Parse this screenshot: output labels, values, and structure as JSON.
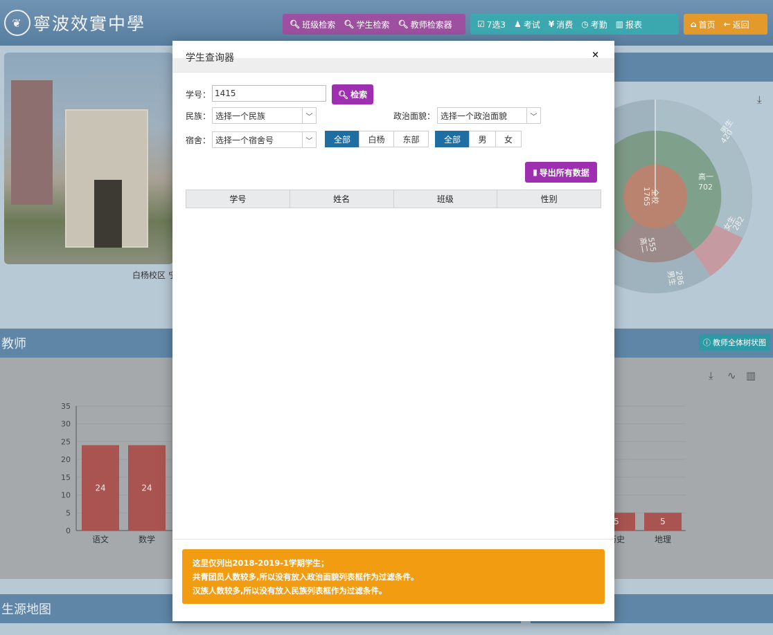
{
  "app": {
    "school_name": "寧波效實中學",
    "nav_search": [
      {
        "icon": "search-icon",
        "label": "班级检索"
      },
      {
        "icon": "search-icon",
        "label": "学生检索"
      },
      {
        "icon": "search-icon",
        "label": "教师检索器"
      }
    ],
    "nav_main": [
      {
        "icon": "check-icon",
        "label": "7选3"
      },
      {
        "icon": "user-icon",
        "label": "考试"
      },
      {
        "icon": "yen-icon",
        "label": "消费"
      },
      {
        "icon": "clock-icon",
        "label": "考勤"
      },
      {
        "icon": "bar-chart-icon",
        "label": "报表"
      }
    ],
    "nav_home": {
      "icon": "home-icon",
      "label": "首页"
    },
    "nav_back": {
      "icon": "arrow-left-icon",
      "label": "返回"
    }
  },
  "background": {
    "photo_caption": "白杨校区 宁",
    "teacher_section": "教师",
    "teacher_tree_button": "教师全体树状图",
    "source_section": "生源地图",
    "chart_data": [
      {
        "type": "bar",
        "categories": [
          "语文",
          "数学",
          "历史",
          "地理"
        ],
        "values": [
          24,
          24,
          5,
          5
        ],
        "ylim": [
          0,
          35
        ],
        "yticks": [
          0,
          5,
          10,
          15,
          20,
          25,
          30,
          35
        ],
        "color": "#a95450"
      },
      {
        "type": "pie",
        "center_label": "全校",
        "center_value": "1765",
        "rings": [
          {
            "label": "高一",
            "value": "702"
          },
          {
            "label": "高二",
            "value": "555"
          },
          {
            "label": "男生",
            "value": "420"
          },
          {
            "label": "女生",
            "value": "282"
          },
          {
            "label": "男生",
            "value": "286"
          }
        ]
      }
    ]
  },
  "modal": {
    "title": "学生查询器",
    "close": "×",
    "student_id_label": "学号：",
    "student_id_value": "1415",
    "search_button": "检索",
    "ethnic_label": "民族：",
    "ethnic_select": "选择一个民族",
    "political_label": "政治面貌：",
    "political_select": "选择一个政治面貌",
    "dorm_label": "宿舍：",
    "dorm_select": "选择一个宿舍号",
    "campus_options": [
      "全部",
      "白杨",
      "东部"
    ],
    "campus_selected": "全部",
    "gender_options": [
      "全部",
      "男",
      "女"
    ],
    "gender_selected": "全部",
    "export_button": "导出所有数据",
    "table_headers": [
      "学号",
      "姓名",
      "班级",
      "性别"
    ],
    "notice_lines": [
      "这里仅列出2018-2019-1学期学生；",
      "共青团员人数较多,所以没有放入政治面貌列表框作为过滤条件。",
      "汉族人数较多,所以没有放入民族列表框作为过滤条件。"
    ],
    "accent_purple": "#9e2fb0",
    "accent_blue": "#1f6ea3",
    "notice_color": "#f29c12"
  }
}
